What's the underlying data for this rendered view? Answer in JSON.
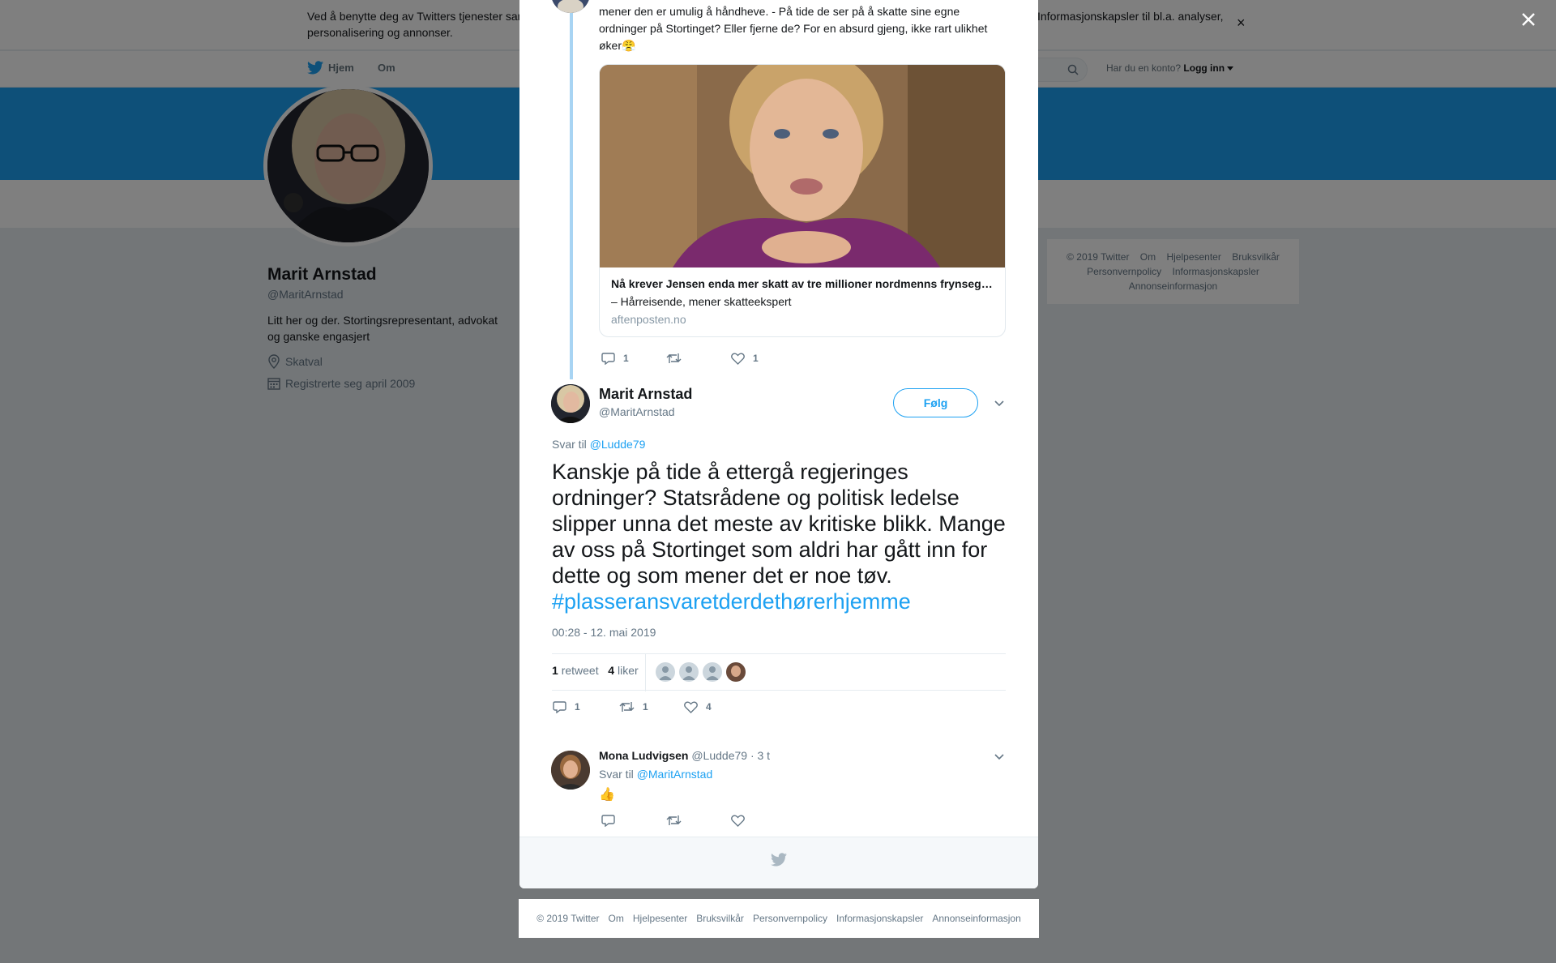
{
  "cookie_banner": {
    "text_left_line1": "Ved å benytte deg av Twitters tjenester samtykker du i vår bruk av",
    "text_left_line2": "personalisering og annonser.",
    "text_right": "Informasjonskapsler til bl.a. analyser,",
    "close_glyph": "×"
  },
  "nav": {
    "home": "Hjem",
    "about": "Om",
    "account_prompt": "Har du en konto?",
    "login": "Logg inn"
  },
  "profile": {
    "name": "Marit Arnstad",
    "handle": "@MaritArnstad",
    "bio": "Litt her og der. Stortingsrepresentant, advokat og ganske engasjert",
    "location": "Skatval",
    "joined": "Registrerte seg april 2009"
  },
  "side_footer": {
    "links": [
      "© 2019 Twitter",
      "Om",
      "Hjelpesenter",
      "Bruksvilkår",
      "Personvernpolicy",
      "Informasjonskapsler",
      "Annonseinformasjon"
    ]
  },
  "previous_tweet": {
    "text": "mener den er umulig å håndheve. - På tide de ser på å skatte sine egne ordninger på Stortinget? Eller fjerne de? For en absurd gjeng, ikke rart ulikhet øker😤",
    "card": {
      "title": "Nå krever Jensen enda mer skatt av tre millioner nordmenns frynsegoder",
      "description": "– Hårreisende, mener skatteekspert",
      "domain": "aftenposten.no"
    },
    "replies": "1",
    "retweets": "",
    "likes": "1"
  },
  "main_tweet": {
    "author_name": "Marit Arnstad",
    "author_handle": "@MaritArnstad",
    "follow_label": "Følg",
    "reply_prefix": "Svar til",
    "reply_handle": "@Ludde79",
    "text": "Kanskje på tide å ettergå regjeringes ordninger? Statsrådene og politisk ledelse slipper unna det meste av kritiske blikk. Mange av oss på Stortinget som aldri har gått inn for dette og som mener det er noe tøv.",
    "hashtag": "#plasseransvaretderdethørerhjemme",
    "timestamp": "00:28 - 12. mai 2019",
    "retweet_count": "1",
    "retweet_label": "retweet",
    "like_count": "4",
    "like_label": "liker",
    "replies": "1",
    "retweets": "1",
    "likes": "4"
  },
  "reply_tweet": {
    "author_name": "Mona Ludvigsen",
    "author_handle": "@Ludde79",
    "time": "· 3 t",
    "reply_prefix": "Svar til",
    "reply_handle": "@MaritArnstad",
    "text": "👍"
  },
  "bottom_footer": {
    "links": [
      "© 2019 Twitter",
      "Om",
      "Hjelpesenter",
      "Bruksvilkår",
      "Personvernpolicy",
      "Informasjonskapsler",
      "Annonseinformasjon"
    ]
  },
  "colors": {
    "brand": "#1da1f2",
    "overlay": "rgba(0,0,0,0.5)",
    "thread_line": "#a8d4f3"
  }
}
